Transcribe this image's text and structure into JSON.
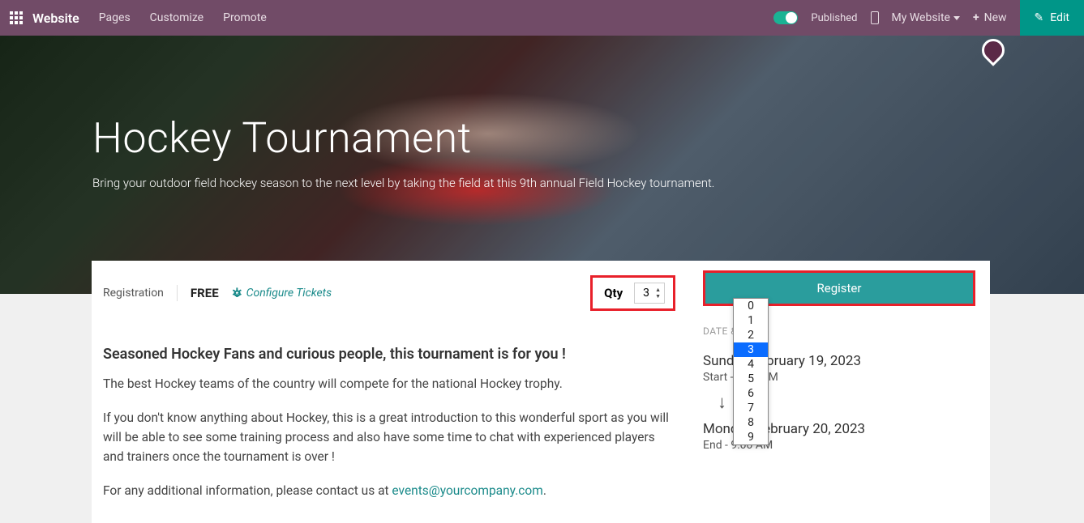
{
  "topbar": {
    "brand": "Website",
    "links": [
      "Pages",
      "Customize",
      "Promote"
    ],
    "published": "Published",
    "my_website": "My Website",
    "new_label": "New",
    "edit_label": "Edit"
  },
  "hero": {
    "title": "Hockey Tournament",
    "subtitle": "Bring your outdoor field hockey season to the next level by taking the field at this 9th annual Field Hockey tournament."
  },
  "registration": {
    "label": "Registration",
    "price": "FREE",
    "configure": "Configure Tickets",
    "qty_label": "Qty",
    "qty_value": "3",
    "qty_options": [
      "0",
      "1",
      "2",
      "3",
      "4",
      "5",
      "6",
      "7",
      "8",
      "9"
    ],
    "selected_index": 3
  },
  "body": {
    "heading": "Seasoned Hockey Fans and curious people, this tournament is for you !",
    "p1": "The best Hockey teams of the country will compete for the national Hockey trophy.",
    "p2": "If you don't know anything about Hockey, this is a great introduction to this wonderful sport as you will will be able to see some training process and also have some time to chat with experienced players and trainers once the tournament is over !",
    "p3_pre": "For any additional information, please contact us at ",
    "email": "events@yourcompany.com",
    "p3_post": "."
  },
  "sidebar": {
    "register": "Register",
    "dt_label": "DATE & TIME",
    "start_date": "Sunday February 19, 2023",
    "start_time": "Start - 1:00 AM",
    "end_date": "Monday February 20, 2023",
    "end_time": "End - 9:00 AM"
  }
}
